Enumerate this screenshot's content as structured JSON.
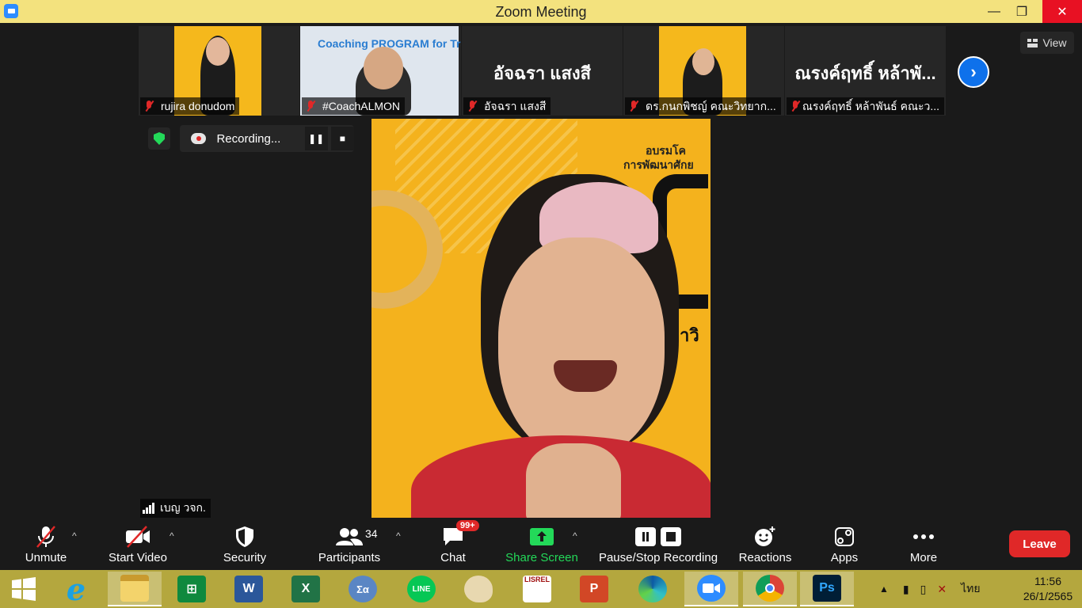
{
  "window": {
    "title": "Zoom Meeting",
    "minimize": "—",
    "maximize": "❐",
    "close": "✕"
  },
  "participants_strip": [
    {
      "name": "rujira donudom",
      "kind": "video"
    },
    {
      "name": "#CoachALMON",
      "kind": "video",
      "banner": "Coaching PROGRAM for Trainer"
    },
    {
      "name": "อัจฉรา แสงสี",
      "kind": "name",
      "big_name": "อัจฉรา แสงสี"
    },
    {
      "name": "ดร.กนกพิชญ์ คณะวิทยาก...",
      "kind": "video"
    },
    {
      "name": "ณรงค์ฤทธิ์ หล้าพันธ์ คณะว...",
      "kind": "name",
      "big_name": "ณรงค์ฤทธิ์ หล้าพั..."
    }
  ],
  "view_button": "View",
  "recording": {
    "label": "Recording..."
  },
  "main_video": {
    "speaker_label": "เบญ วจก.",
    "poster_text_1": "อบรมโค",
    "poster_text_2": "การพัฒนาศักย",
    "poster_text_3": "มหาวิ"
  },
  "toolbar": {
    "unmute": "Unmute",
    "start_video": "Start Video",
    "security": "Security",
    "participants": "Participants",
    "participants_count": "34",
    "chat": "Chat",
    "chat_badge": "99+",
    "share_screen": "Share Screen",
    "pause_stop_recording": "Pause/Stop Recording",
    "reactions": "Reactions",
    "apps": "Apps",
    "more": "More",
    "leave": "Leave"
  },
  "taskbar": {
    "apps": [
      {
        "name": "start",
        "label": ""
      },
      {
        "name": "internet-explorer",
        "label": "e"
      },
      {
        "name": "file-explorer",
        "label": ""
      },
      {
        "name": "store",
        "label": ""
      },
      {
        "name": "word",
        "label": "W"
      },
      {
        "name": "excel",
        "label": "X"
      },
      {
        "name": "math-input",
        "label": "Σα"
      },
      {
        "name": "line",
        "label": "LINE"
      },
      {
        "name": "paint",
        "label": ""
      },
      {
        "name": "lisrel",
        "label": "LISREL"
      },
      {
        "name": "powerpoint",
        "label": "P"
      },
      {
        "name": "edge",
        "label": ""
      },
      {
        "name": "zoom",
        "label": ""
      },
      {
        "name": "chrome",
        "label": ""
      },
      {
        "name": "photoshop",
        "label": "Ps"
      }
    ],
    "language": "ไทย",
    "time": "11:56",
    "date": "26/1/2565"
  },
  "colors": {
    "titlebar": "#f3e27e",
    "taskbar": "#b4a73e",
    "leave": "#e02828",
    "share": "#23d959",
    "zoom_blue": "#0e71eb"
  }
}
